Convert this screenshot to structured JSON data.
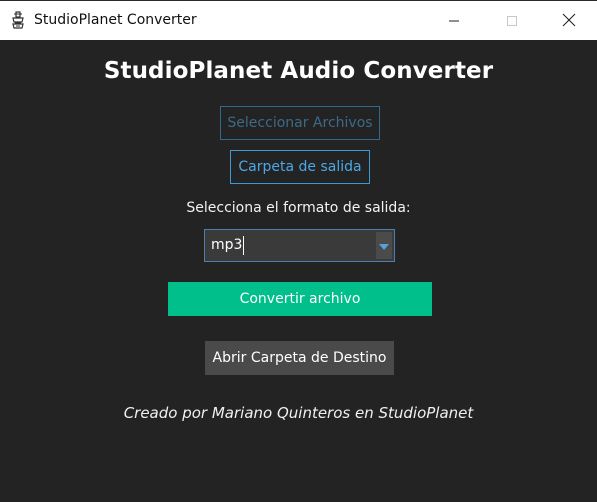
{
  "window": {
    "title": "StudioPlanet Converter",
    "icon": "app-logo-icon",
    "controls": {
      "minimize_icon": "minimize-icon",
      "maximize_icon": "maximize-icon",
      "close_icon": "close-icon"
    }
  },
  "main": {
    "title": "StudioPlanet Audio Converter",
    "select_files_label": "Seleccionar Archivos",
    "output_folder_label": "Carpeta de salida",
    "format_prompt": "Selecciona el formato de salida:",
    "format_value": "mp3",
    "convert_label": "Convertir archivo",
    "open_folder_label": "Abrir Carpeta de Destino",
    "credits": "Creado por Mariano Quinteros en StudioPlanet"
  },
  "colors": {
    "background": "#232323",
    "accent_green": "#00bf8a",
    "accent_blue": "#4aa8e6",
    "disabled_blue": "#3d6a86",
    "secondary_button": "#4a4a4a"
  }
}
